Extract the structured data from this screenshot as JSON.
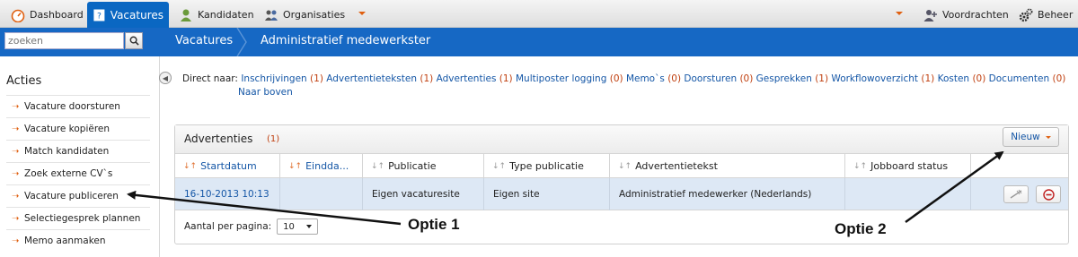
{
  "topnav": {
    "tabs": [
      {
        "label": "Dashboard",
        "icon": "dashboard-icon"
      },
      {
        "label": "Vacatures",
        "icon": "vacancy-icon",
        "active": true
      },
      {
        "label": "Kandidaten",
        "icon": "candidate-icon"
      },
      {
        "label": "Organisaties",
        "icon": "organisations-icon"
      }
    ],
    "right": [
      {
        "label": "Voordrachten",
        "icon": "add-user-icon"
      },
      {
        "label": "Beheer",
        "icon": "gears-icon"
      }
    ]
  },
  "search": {
    "placeholder": "zoeken"
  },
  "breadcrumb": {
    "section": "Vacatures",
    "title": "Administratief medewerkster"
  },
  "sidebar": {
    "title": "Acties",
    "items": [
      "Vacature doorsturen",
      "Vacature kopiëren",
      "Match kandidaten",
      "Zoek externe CV`s",
      "Vacature publiceren",
      "Selectiegesprek plannen",
      "Memo aanmaken"
    ]
  },
  "direct": {
    "label": "Direct naar:",
    "links": [
      {
        "label": "Inschrijvingen",
        "count": "(1)"
      },
      {
        "label": "Advertentieteksten",
        "count": "(1)"
      },
      {
        "label": "Advertenties",
        "count": "(1)"
      },
      {
        "label": "Multiposter logging",
        "count": "(0)"
      },
      {
        "label": "Memo`s",
        "count": "(0)"
      },
      {
        "label": "Doorsturen",
        "count": "(0)"
      },
      {
        "label": "Gesprekken",
        "count": "(1)"
      },
      {
        "label": "Workflowoverzicht",
        "count": "(1)"
      },
      {
        "label": "Kosten",
        "count": "(0)"
      },
      {
        "label": "Documenten",
        "count": "(0)"
      }
    ],
    "top_link": "Naar boven"
  },
  "panel": {
    "title": "Advertenties",
    "count": "(1)",
    "new_button": "Nieuw",
    "columns": [
      "Startdatum",
      "Eindda...",
      "Publicatie",
      "Type publicatie",
      "Advertentietekst",
      "Jobboard status"
    ],
    "rows": [
      {
        "start": "16-10-2013 10:13",
        "end": "",
        "publicatie": "Eigen vacaturesite",
        "type": "Eigen site",
        "tekst": "Administratief medewerker (Nederlands)",
        "status": ""
      }
    ],
    "paging_label": "Aantal per pagina:",
    "paging_value": "10"
  },
  "annotations": {
    "optie1": "Optie 1",
    "optie2": "Optie 2"
  }
}
